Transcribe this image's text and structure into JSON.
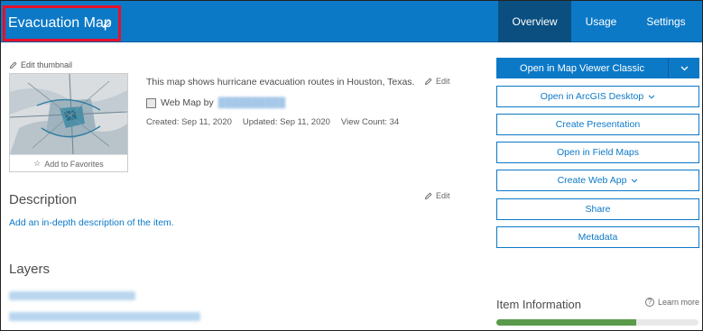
{
  "header": {
    "title": "Evacuation Map",
    "tabs": [
      {
        "label": "Overview",
        "active": true
      },
      {
        "label": "Usage",
        "active": false
      },
      {
        "label": "Settings",
        "active": false
      }
    ]
  },
  "thumbnail": {
    "edit_label": "Edit thumbnail",
    "favorite_label": "Add to Favorites"
  },
  "summary": {
    "text": "This map shows hurricane evacuation routes in Houston, Texas.",
    "edit_label": "Edit",
    "type_label": "Web Map by",
    "created": "Created: Sep 11, 2020",
    "updated": "Updated: Sep 11, 2020",
    "view_count": "View Count: 34"
  },
  "description": {
    "heading": "Description",
    "edit_label": "Edit",
    "add_link": "Add an in-depth description of the item."
  },
  "layers": {
    "heading": "Layers"
  },
  "actions": {
    "open_map_viewer": "Open in Map Viewer Classic",
    "open_arcgis_desktop": "Open in ArcGIS Desktop",
    "create_presentation": "Create Presentation",
    "open_field_maps": "Open in Field Maps",
    "create_web_app": "Create Web App",
    "share": "Share",
    "metadata": "Metadata"
  },
  "item_information": {
    "heading": "Item Information",
    "learn_more": "Learn more",
    "progress_fraction": 0.69
  },
  "colors": {
    "brand": "#0c79c7",
    "highlight": "#e8102a",
    "progress": "#5a9a4a"
  },
  "icons": [
    "pencil-icon",
    "star-icon",
    "web-map-icon",
    "chevron-down-icon",
    "info-icon"
  ]
}
